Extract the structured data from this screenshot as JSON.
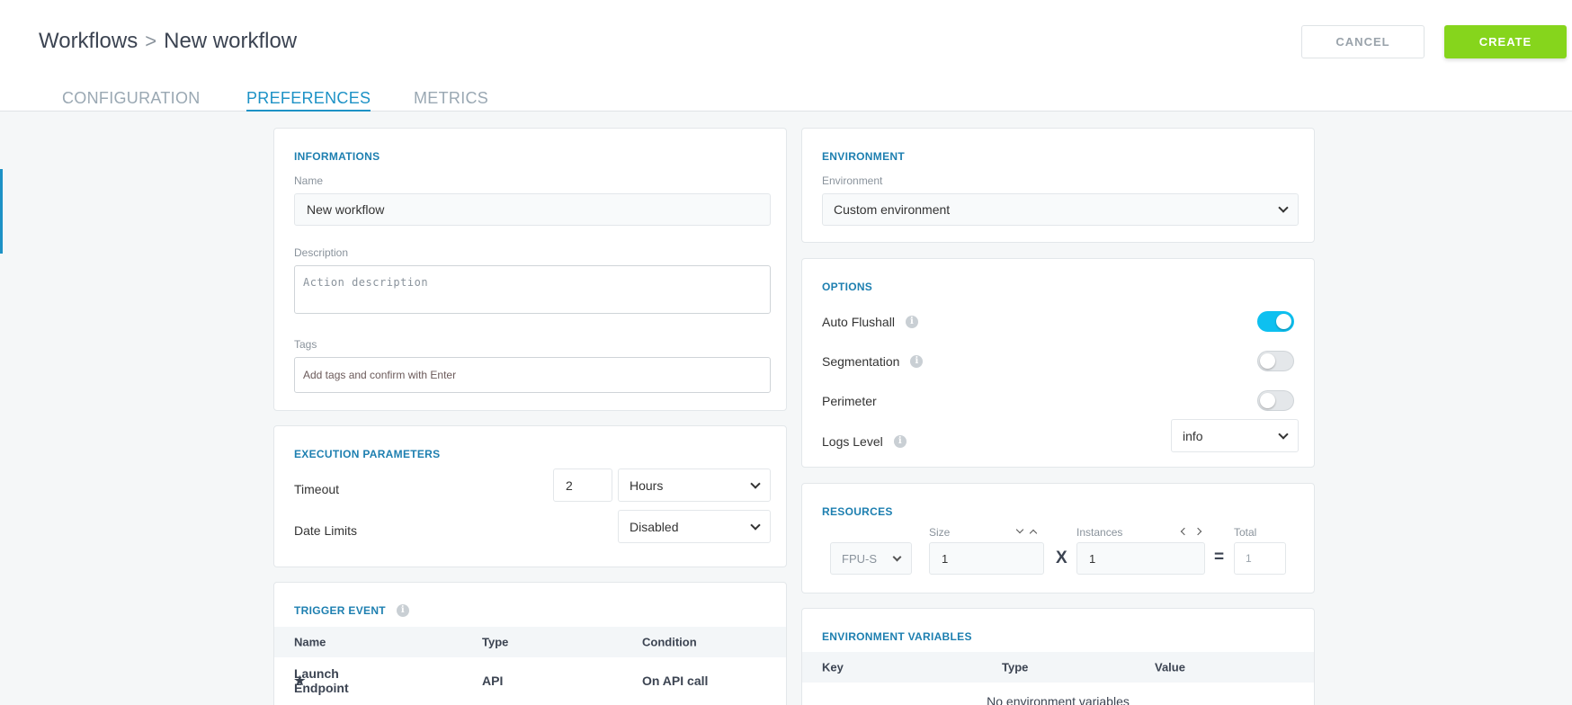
{
  "header": {
    "breadcrumb_root": "Workflows",
    "breadcrumb_sep": ">",
    "breadcrumb_current": "New workflow",
    "cancel_label": "CANCEL",
    "create_label": "CREATE"
  },
  "tabs": [
    {
      "label": "CONFIGURATION"
    },
    {
      "label": "PREFERENCES",
      "active": true
    },
    {
      "label": "METRICS"
    }
  ],
  "informations": {
    "title": "INFORMATIONS",
    "name_label": "Name",
    "name_value": "New workflow",
    "description_label": "Description",
    "description_placeholder": "Action description",
    "tags_label": "Tags",
    "tags_placeholder": "Add tags and confirm with Enter"
  },
  "execution": {
    "title": "EXECUTION PARAMETERS",
    "timeout_label": "Timeout",
    "timeout_value": "2",
    "timeout_unit": "Hours",
    "date_limits_label": "Date Limits",
    "date_limits_value": "Disabled"
  },
  "trigger": {
    "title": "TRIGGER EVENT",
    "columns": [
      "Name",
      "Type",
      "Condition"
    ],
    "rows": [
      {
        "name": "Launch Endpoint",
        "type": "API",
        "condition": "On API call"
      }
    ]
  },
  "environment": {
    "title": "ENVIRONMENT",
    "env_label": "Environment",
    "env_value": "Custom environment"
  },
  "options": {
    "title": "OPTIONS",
    "auto_flushall_label": "Auto Flushall",
    "auto_flushall_on": true,
    "segmentation_label": "Segmentation",
    "segmentation_on": false,
    "perimeter_label": "Perimeter",
    "perimeter_on": false,
    "logs_level_label": "Logs Level",
    "logs_level_value": "info"
  },
  "resources": {
    "title": "RESOURCES",
    "fpu_value": "FPU-S",
    "size_label": "Size",
    "size_value": "1",
    "instances_label": "Instances",
    "instances_value": "1",
    "total_label": "Total",
    "total_value": "1",
    "multiply_sign": "X",
    "equals_sign": "="
  },
  "env_vars": {
    "title": "ENVIRONMENT VARIABLES",
    "columns": [
      "Key",
      "Type",
      "Value"
    ],
    "empty_text": "No environment variables"
  },
  "colors": {
    "accent": "#1d92c6",
    "create": "#86d51c",
    "toggle_on": "#0ec0f0"
  }
}
